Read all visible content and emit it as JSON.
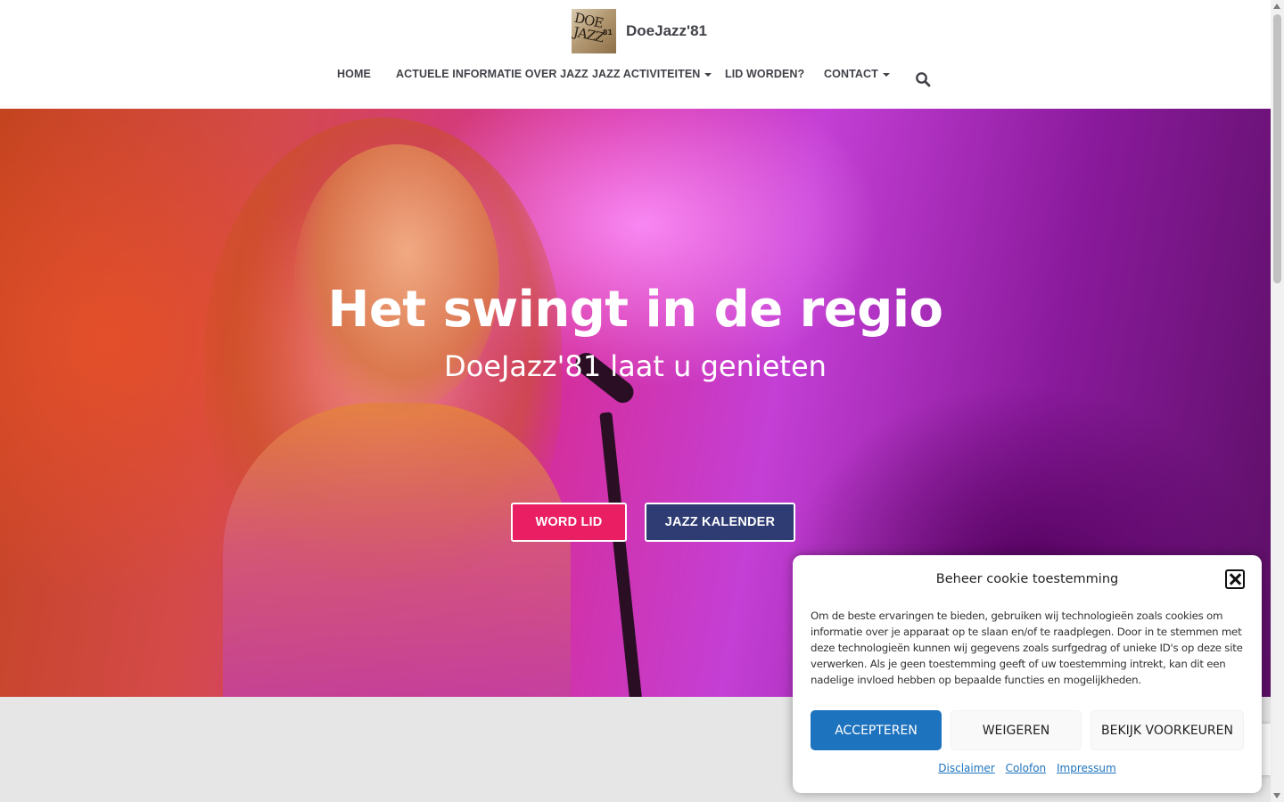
{
  "header": {
    "brand_name": "DoeJazz'81",
    "logo_text": {
      "line1": "DOE",
      "line2": "JAZZ",
      "small": "81"
    }
  },
  "nav": {
    "items": [
      {
        "label": "HOME",
        "has_caret": false
      },
      {
        "label": "ACTUELE INFORMATIE OVER JAZZ",
        "has_caret": false
      },
      {
        "label": "JAZZ ACTIVITEITEN",
        "has_caret": true
      },
      {
        "label": "LID WORDEN?",
        "has_caret": false
      },
      {
        "label": "CONTACT",
        "has_caret": true
      }
    ],
    "search_icon": "search-icon"
  },
  "hero": {
    "title": "Het swingt in de regio",
    "subtitle": "DoeJazz'81 laat u genieten",
    "buttons": {
      "primary": "WORD LID",
      "secondary": "JAZZ KALENDER"
    }
  },
  "cookie": {
    "title": "Beheer cookie toestemming",
    "text": "Om de beste ervaringen te bieden, gebruiken wij technologieën zoals cookies om informatie over je apparaat op te slaan en/of te raadplegen. Door in te stemmen met deze technologieën kunnen wij gegevens zoals surfgedrag of unieke ID's op deze site verwerken. Als je geen toestemming geeft of uw toestemming intrekt, kan dit een nadelige invloed hebben op bepaalde functies en mogelijkheden.",
    "accept": "ACCEPTEREN",
    "deny": "WEIGEREN",
    "preferences": "BEKIJK VOORKEUREN",
    "links": {
      "disclaimer": "Disclaimer",
      "colofon": "Colofon",
      "impressum": "Impressum"
    }
  },
  "colors": {
    "accent_red": "#e91e63",
    "accent_blue": "#2e3c73",
    "cookie_accept": "#1e73be",
    "nav_text": "#404248"
  }
}
